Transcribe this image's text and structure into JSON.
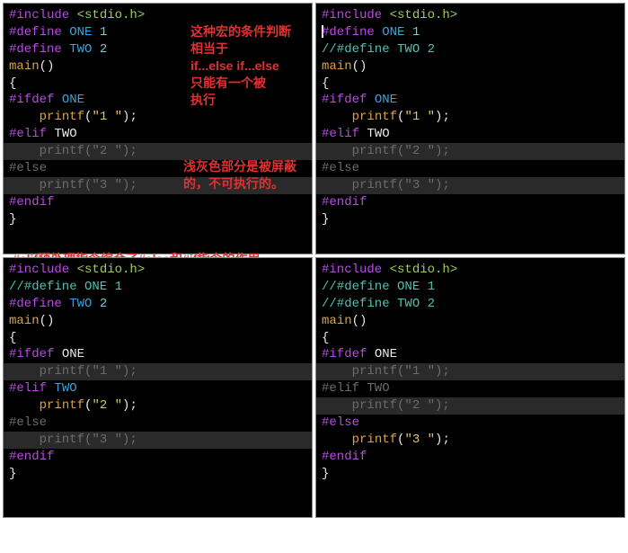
{
  "annotations": {
    "a1": "这种宏的条件判断\n相当于\nif...else if...else\n只能有一个被\n执行",
    "a2": "浅灰色部分是被屏蔽\n的，不可执行的。",
    "a3": "#elif预处理指令综合了#else和#if指令的作用。"
  },
  "tokens": {
    "include": "#include",
    "define": "#define",
    "ifdef": "#ifdef",
    "elif_d": "#elif",
    "else_d": "#else",
    "endif": "#endif",
    "stdio": "<stdio.h>",
    "one": "ONE",
    "two": "TWO",
    "n1": "1",
    "n2": "2",
    "main": "main",
    "printf": "printf",
    "s1": "\"1 \"",
    "s2": "\"2 \"",
    "s3": "\"3 \"",
    "lp": "(",
    "rp": ")",
    "lb": "{",
    "rb": "}",
    "sc": ";",
    "cmt_one": "//#define ONE 1",
    "cmt_two": "//#define TWO 2"
  },
  "panes": {
    "p1_desc": "ONE defined, TWO defined → printf 1 active; elif/else greyed",
    "p2_desc": "ONE defined, TWO commented → printf 1 active",
    "p3_desc": "ONE commented, TWO defined → printf 2 active",
    "p4_desc": "ONE commented, TWO commented → printf 3 active"
  }
}
